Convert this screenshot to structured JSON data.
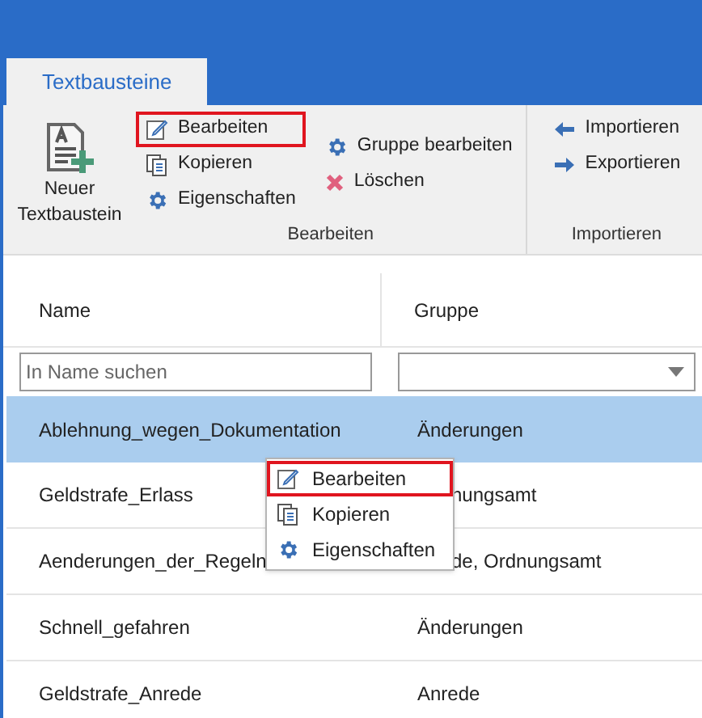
{
  "tabs": [
    {
      "label": "Textbausteine",
      "selected": true
    }
  ],
  "ribbon": {
    "new_button": {
      "label_lines": [
        "Neuer",
        "Textbaustein"
      ]
    },
    "groups": [
      {
        "label": "Bearbeiten",
        "columns": [
          [
            {
              "label": "Bearbeiten",
              "kind": "edit",
              "highlighted": true
            },
            {
              "label": "Kopieren",
              "kind": "copy",
              "highlighted": false
            },
            {
              "label": "Eigenschaften",
              "kind": "gear",
              "highlighted": false
            }
          ],
          [
            {
              "label": "Gruppe bearbeiten",
              "kind": "gear",
              "highlighted": false
            },
            {
              "label": "Löschen",
              "kind": "delete",
              "highlighted": false
            }
          ]
        ]
      },
      {
        "label": "Importieren",
        "columns": [
          [
            {
              "label": "Importieren",
              "kind": "import",
              "highlighted": false
            },
            {
              "label": "Exportieren",
              "kind": "export",
              "highlighted": false
            }
          ]
        ]
      }
    ]
  },
  "table": {
    "columns": [
      "Name",
      "Gruppe"
    ],
    "filter": {
      "placeholder": "In Name suchen"
    },
    "rows": [
      {
        "name": "Ablehnung_wegen_Dokumentation",
        "group": "Änderungen",
        "selected": true,
        "group_covered": false
      },
      {
        "name": "Geldstrafe_Erlass",
        "group": "nungsamt",
        "selected": false,
        "group_covered": true
      },
      {
        "name": "Aenderungen_der_Regeln",
        "group": "de, Ordnungsamt",
        "selected": false,
        "group_covered": true
      },
      {
        "name": "Schnell_gefahren",
        "group": "Änderungen",
        "selected": false,
        "group_covered": false
      },
      {
        "name": "Geldstrafe_Anrede",
        "group": "Anrede",
        "selected": false,
        "group_covered": false
      }
    ]
  },
  "context_menu": {
    "items": [
      {
        "label": "Bearbeiten",
        "kind": "edit",
        "highlighted": true
      },
      {
        "label": "Kopieren",
        "kind": "copy",
        "highlighted": false
      },
      {
        "label": "Eigenschaften",
        "kind": "gear",
        "highlighted": false
      }
    ]
  }
}
